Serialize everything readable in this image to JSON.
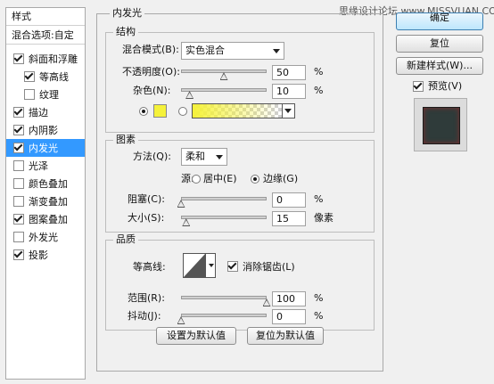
{
  "watermark": "思缘设计论坛 www.MISSVUAN.COM",
  "styles_list": {
    "header": "样式",
    "blend_options": "混合选项:自定",
    "items": [
      {
        "label": "斜面和浮雕",
        "checked": true,
        "sub": false,
        "selected": false
      },
      {
        "label": "等高线",
        "checked": true,
        "sub": true,
        "selected": false
      },
      {
        "label": "纹理",
        "checked": false,
        "sub": true,
        "selected": false
      },
      {
        "label": "描边",
        "checked": true,
        "sub": false,
        "selected": false
      },
      {
        "label": "内阴影",
        "checked": true,
        "sub": false,
        "selected": false
      },
      {
        "label": "内发光",
        "checked": true,
        "sub": false,
        "selected": true
      },
      {
        "label": "光泽",
        "checked": false,
        "sub": false,
        "selected": false
      },
      {
        "label": "颜色叠加",
        "checked": false,
        "sub": false,
        "selected": false
      },
      {
        "label": "渐变叠加",
        "checked": false,
        "sub": false,
        "selected": false
      },
      {
        "label": "图案叠加",
        "checked": true,
        "sub": false,
        "selected": false
      },
      {
        "label": "外发光",
        "checked": false,
        "sub": false,
        "selected": false
      },
      {
        "label": "投影",
        "checked": true,
        "sub": false,
        "selected": false
      }
    ]
  },
  "panel": {
    "title": "内发光",
    "structure": {
      "title": "结构",
      "blend_mode_label": "混合模式(B):",
      "blend_mode_value": "实色混合",
      "opacity_label": "不透明度(O):",
      "opacity_value": "50",
      "opacity_unit": "%",
      "opacity_fraction": 0.5,
      "noise_label": "杂色(N):",
      "noise_value": "10",
      "noise_unit": "%",
      "noise_fraction": 0.1,
      "color_swatch": "#f5f23a",
      "gradient_from": "#f5f23a"
    },
    "elements": {
      "title": "图素",
      "method_label": "方法(Q):",
      "method_value": "柔和",
      "source_label": "源:",
      "source_center": "居中(E)",
      "source_edge": "边缘(G)",
      "choke_label": "阻塞(C):",
      "choke_value": "0",
      "choke_unit": "%",
      "choke_fraction": 0,
      "size_label": "大小(S):",
      "size_value": "15",
      "size_unit": "像素",
      "size_fraction": 0.06
    },
    "quality": {
      "title": "品质",
      "contour_label": "等高线:",
      "anti_alias_label": "消除锯齿(L)",
      "anti_alias_checked": true,
      "range_label": "范围(R):",
      "range_value": "100",
      "range_unit": "%",
      "range_fraction": 1,
      "jitter_label": "抖动(J):",
      "jitter_value": "0",
      "jitter_unit": "%",
      "jitter_fraction": 0
    },
    "make_default_label": "设置为默认值",
    "reset_default_label": "复位为默认值"
  },
  "buttons": {
    "ok_label": "确定",
    "reset_label": "复位",
    "new_style_label": "新建样式(W)...",
    "preview_label": "预览(V)",
    "preview_checked": true
  }
}
